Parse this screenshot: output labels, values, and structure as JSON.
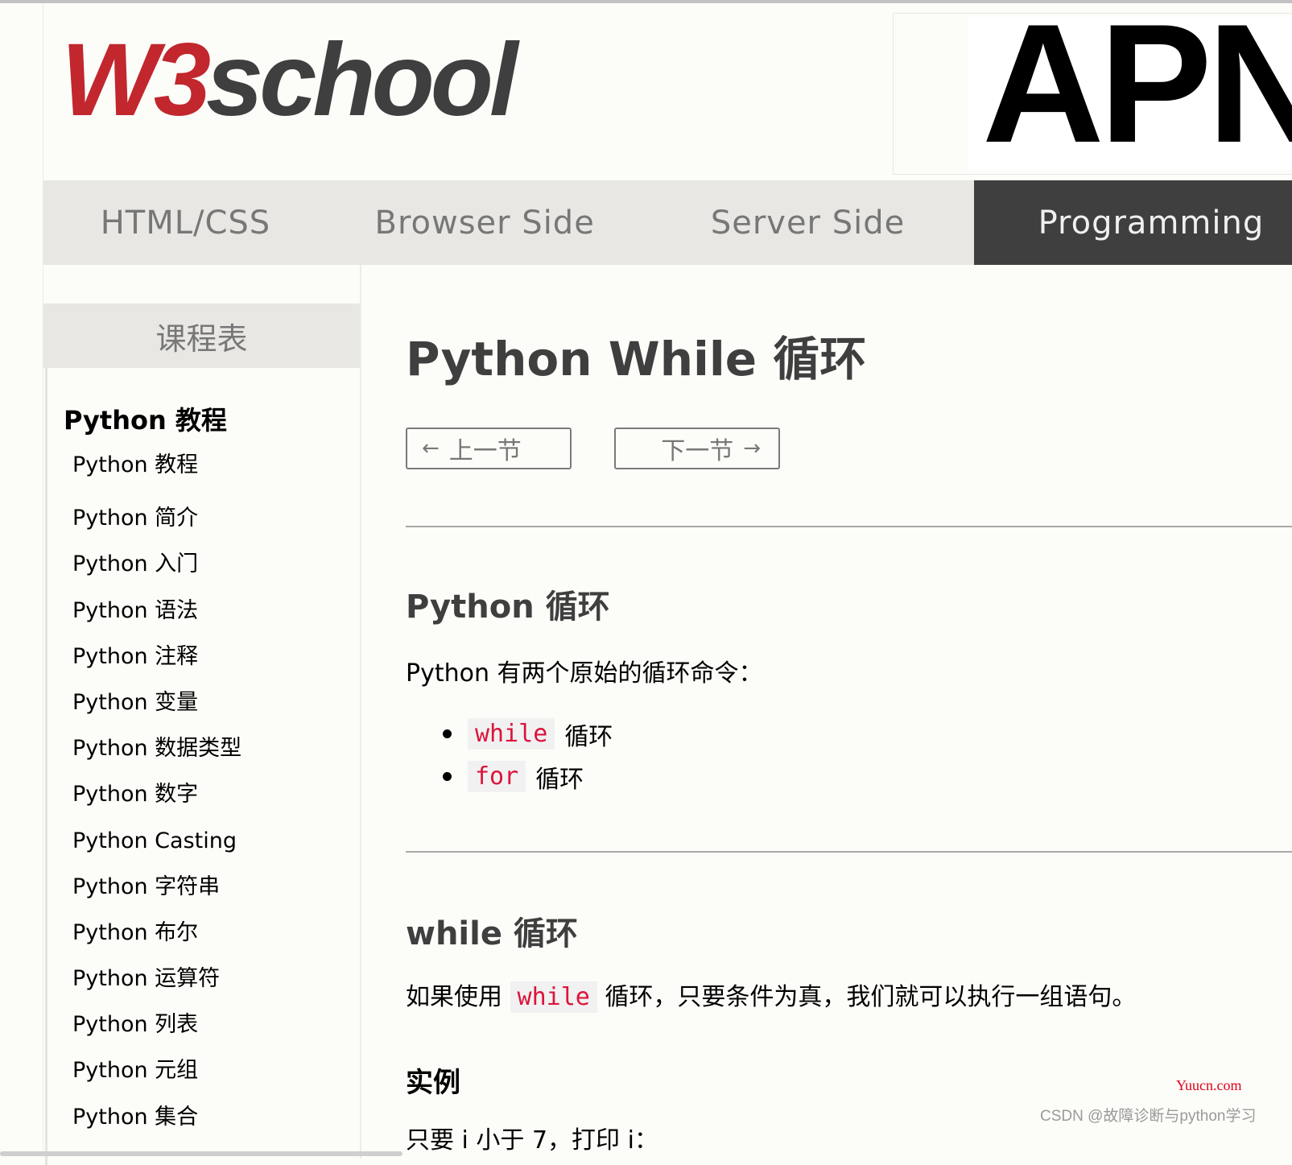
{
  "header": {
    "logo": {
      "part1": "W3",
      "part2": "school"
    },
    "ad": {
      "text": "APN"
    }
  },
  "nav": {
    "items": [
      {
        "label": "HTML/CSS",
        "active": false
      },
      {
        "label": "Browser Side",
        "active": false
      },
      {
        "label": "Server Side",
        "active": false
      },
      {
        "label": "Programming",
        "active": true
      }
    ]
  },
  "sidebar": {
    "header": "课程表",
    "section_title": "Python 教程",
    "items": [
      "Python 教程",
      "Python 简介",
      "Python 入门",
      "Python 语法",
      "Python 注释",
      "Python 变量",
      "Python 数据类型",
      "Python 数字",
      "Python Casting",
      "Python 字符串",
      "Python 布尔",
      "Python 运算符",
      "Python 列表",
      "Python 元组",
      "Python 集合"
    ]
  },
  "main": {
    "title": "Python While 循环",
    "prev_button": {
      "arrow": "←",
      "label": "上一节"
    },
    "next_button": {
      "arrow": "→",
      "label": "下一节"
    },
    "section1": {
      "heading": "Python 循环",
      "intro": "Python 有两个原始的循环命令：",
      "bullets": [
        {
          "code": "while",
          "text": "循环"
        },
        {
          "code": "for",
          "text": "循环"
        }
      ]
    },
    "section2": {
      "heading": "while 循环",
      "para_before": "如果使用",
      "para_code": "while",
      "para_after": "循环，只要条件为真，我们就可以执行一组语句。",
      "example_heading": "实例",
      "example_desc_partial": "只要 i 小于 7，打印 i："
    }
  },
  "watermarks": {
    "site": "Yuucn.com",
    "author": "CSDN @故障诊断与python学习"
  },
  "colors": {
    "brand_red": "#c1272d",
    "dark_gray": "#3f3f3f",
    "nav_bg": "#e8e7e4",
    "code_red": "#dc143c"
  }
}
